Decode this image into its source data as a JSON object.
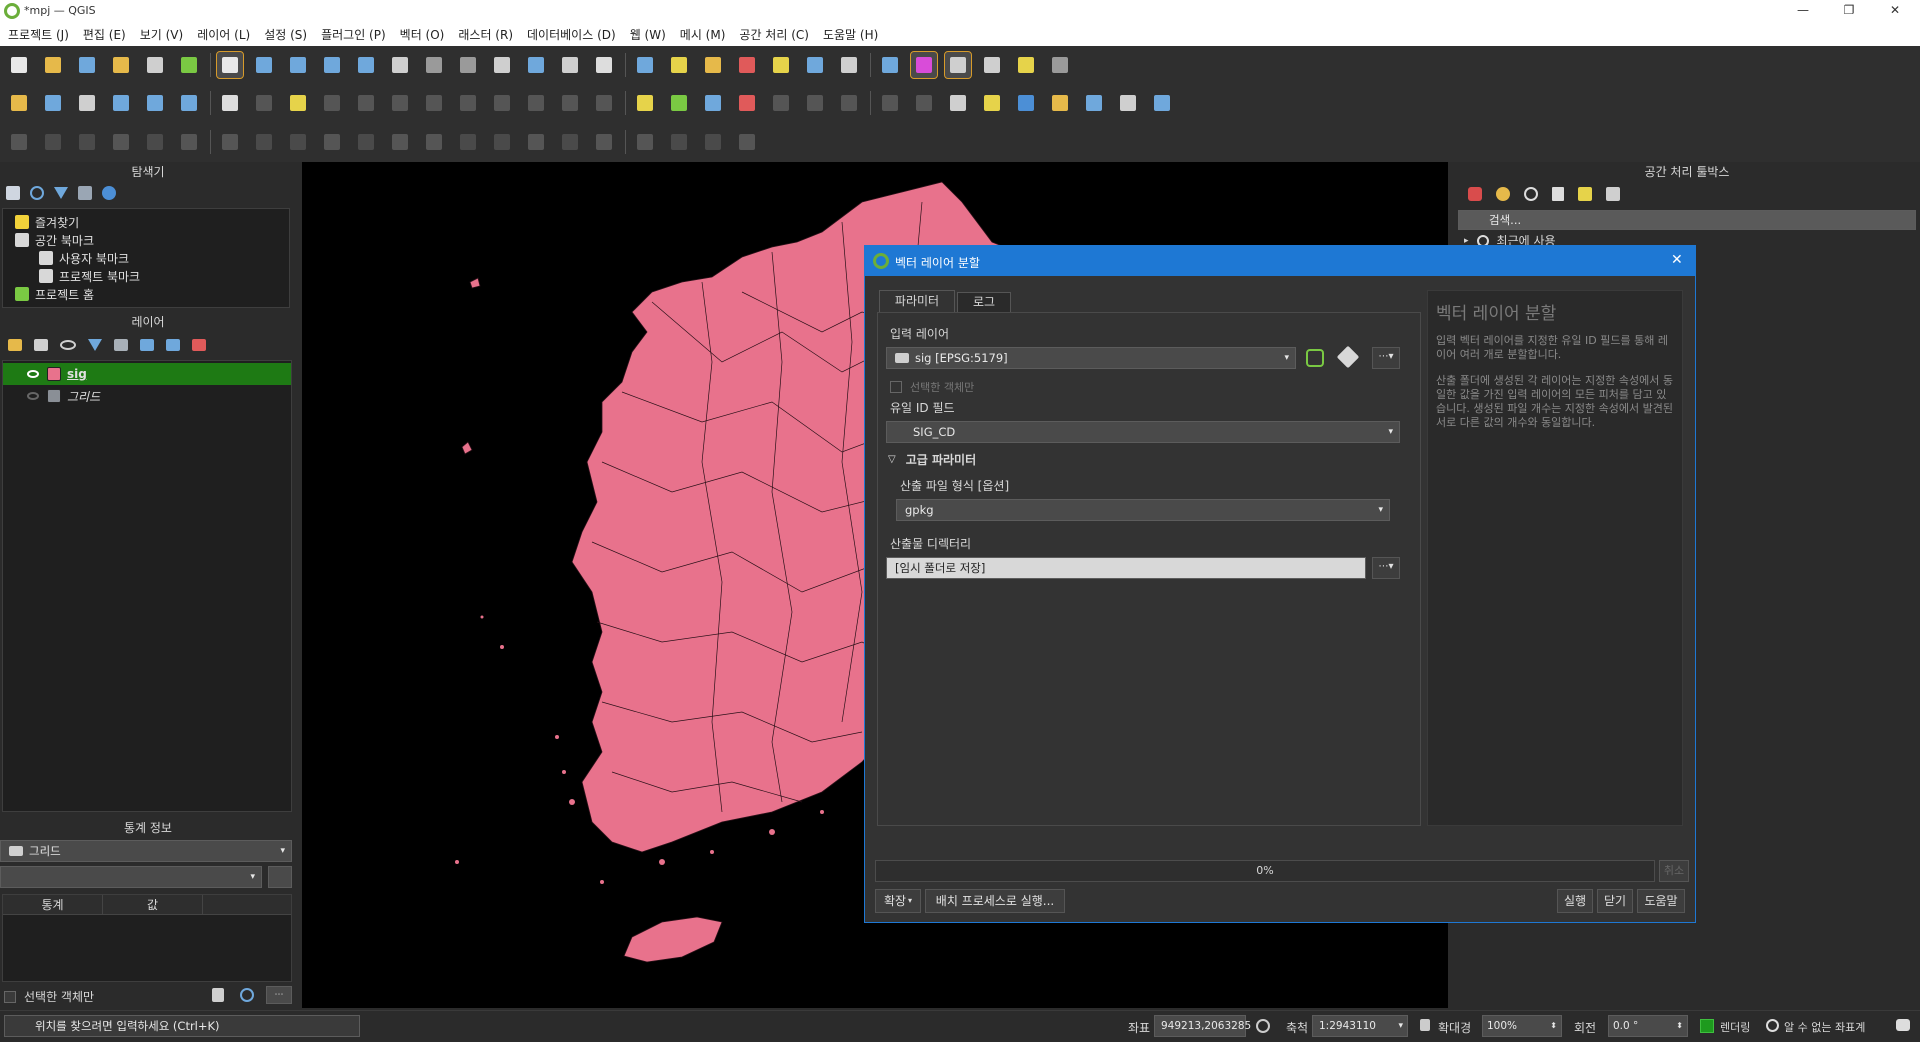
{
  "window": {
    "title": "*mpj — QGIS",
    "minimize": "—",
    "restore": "❐",
    "close": "✕"
  },
  "menu": [
    "프로젝트 (J)",
    "편집 (E)",
    "보기 (V)",
    "레이어 (L)",
    "설정 (S)",
    "플러그인 (P)",
    "벡터 (O)",
    "래스터 (R)",
    "데이터베이스 (D)",
    "웹 (W)",
    "메시 (M)",
    "공간 처리 (C)",
    "도움말 (H)"
  ],
  "browser": {
    "title": "탐색기",
    "items": [
      {
        "label": "즐겨찾기",
        "icon": "star-icon"
      },
      {
        "label": "공간 북마크",
        "icon": "bookmark-icon"
      },
      {
        "label": "사용자 북마크",
        "icon": "folder-icon"
      },
      {
        "label": "프로젝트 북마크",
        "icon": "folder-icon"
      },
      {
        "label": "프로젝트 홈",
        "icon": "project-home-icon"
      }
    ]
  },
  "layers": {
    "title": "레이어",
    "items": [
      {
        "label": "sig",
        "color": "#e8728c",
        "selected": true
      },
      {
        "label": "그리드",
        "color": "#8a8f96",
        "selected": false
      }
    ]
  },
  "stats": {
    "title": "통계 정보",
    "layer": "그리드",
    "col_stat": "통계",
    "col_value": "값",
    "selected_only": "선택한 객체만"
  },
  "toolbox": {
    "title": "공간 처리 툴박스",
    "search_placeholder": "검색...",
    "recent": "최근에 사용"
  },
  "dialog": {
    "title": "벡터 레이어 분할",
    "tab_params": "파라미터",
    "tab_log": "로그",
    "input_layer_label": "입력 레이어",
    "input_layer_value": "sig [EPSG:5179]",
    "selected_only": "선택한 객체만",
    "unique_field_label": "유일 ID 필드",
    "unique_field_value": "SIG_CD",
    "advanced_label": "고급 파라미터",
    "format_label": "산출 파일 형식 [옵션]",
    "format_value": "gpkg",
    "outdir_label": "산출물 디렉터리",
    "outdir_value": "[임시 폴더로 저장]",
    "help_title": "벡터 레이어 분할",
    "help_p1": "입력 벡터 레이어를 지정한 유일 ID 필드를 통해 레이어 여러 개로 분할합니다.",
    "help_p2": "산출 폴더에 생성된 각 레이어는 지정한 속성에서 동일한 값을 가진 입력 레이어의 모든 피처를 담고 있습니다. 생성된 파일 개수는 지정한 속성에서 발견된 서로 다른 값의 개수와 동일합니다.",
    "progress": "0%",
    "cancel": "취소",
    "expand": "확장",
    "batch": "배치 프로세스로 실행...",
    "run": "실행",
    "close": "닫기",
    "help": "도움말"
  },
  "status": {
    "locator_placeholder": "위치를 찾으려면 입력하세요 (Ctrl+K)",
    "coord_label": "좌표",
    "coord_value": "949213,2063285",
    "scale_label": "축척",
    "scale_value": "1:2943110",
    "magnifier_label": "확대경",
    "magnifier_value": "100%",
    "rotation_label": "회전",
    "rotation_value": "0.0 °",
    "render_label": "렌더링",
    "crs_label": "알 수 없는 좌표계"
  },
  "colors": {
    "accent": "#1e78d4",
    "layer_selected": "#1e7a14",
    "map_fill": "#e8728c"
  }
}
